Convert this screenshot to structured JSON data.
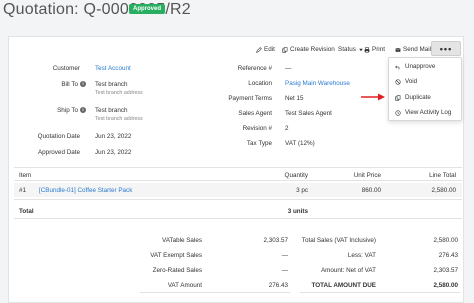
{
  "header": {
    "title": "Quotation: Q-0000005/R2",
    "status_badge": "Approved"
  },
  "toolbar": {
    "edit": "Edit",
    "create_revision": "Create Revision",
    "status": "Status",
    "print": "Print",
    "send_mail": "Send Mail",
    "more": "•••"
  },
  "dropdown": {
    "unapprove": "Unapprove",
    "void": "Void",
    "duplicate": "Duplicate",
    "view_activity_log": "View Activity Log"
  },
  "left_fields": {
    "customer_label": "Customer",
    "customer_value": "Test Account",
    "bill_to_label": "Bill To",
    "bill_to_value": "Test branch",
    "bill_to_sub": "Test branch address",
    "ship_to_label": "Ship To",
    "ship_to_value": "Test branch",
    "ship_to_sub": "Test branch address",
    "quotation_date_label": "Quotation Date",
    "quotation_date_value": "Jun 23, 2022",
    "approved_date_label": "Approved Date",
    "approved_date_value": "Jun 23, 2022"
  },
  "right_fields": {
    "reference_label": "Reference #",
    "reference_value": "—",
    "location_label": "Location",
    "location_value": "Pasig Main Warehouse",
    "payment_terms_label": "Payment Terms",
    "payment_terms_value": "Net 15",
    "sales_agent_label": "Sales Agent",
    "sales_agent_value": "Test Sales Agent",
    "revision_label": "Revision #",
    "revision_value": "2",
    "tax_type_label": "Tax Type",
    "tax_type_value": "VAT (12%)"
  },
  "table": {
    "headers": {
      "item": "Item",
      "quantity": "Quantity",
      "unit_price": "Unit Price",
      "line_total": "Line Total"
    },
    "rows": [
      {
        "num": "#1",
        "item": "[CBundle-01] Coffee Starter Pack",
        "quantity": "3 pc",
        "unit_price": "860.00",
        "line_total": "2,580.00"
      }
    ],
    "total_label": "Total",
    "total_units": "3 units"
  },
  "summary_left": {
    "vatable_sales_label": "VATable Sales",
    "vatable_sales_value": "2,303.57",
    "vat_exempt_label": "VAT Exempt Sales",
    "vat_exempt_value": "—",
    "zero_rated_label": "Zero-Rated Sales",
    "zero_rated_value": "—",
    "vat_amount_label": "VAT Amount",
    "vat_amount_value": "276.43"
  },
  "summary_right": {
    "total_sales_label": "Total Sales (VAT Inclusive)",
    "total_sales_value": "2,580.00",
    "less_vat_label": "Less: VAT",
    "less_vat_value": "276.43",
    "amount_net_label": "Amount: Net of VAT",
    "amount_net_value": "2,303.57",
    "total_due_label": "TOTAL AMOUNT DUE",
    "total_due_value": "2,580.00"
  },
  "colors": {
    "badge": "#27ae60",
    "link": "#2a7bd0",
    "annotation_arrow": "#e02020"
  }
}
